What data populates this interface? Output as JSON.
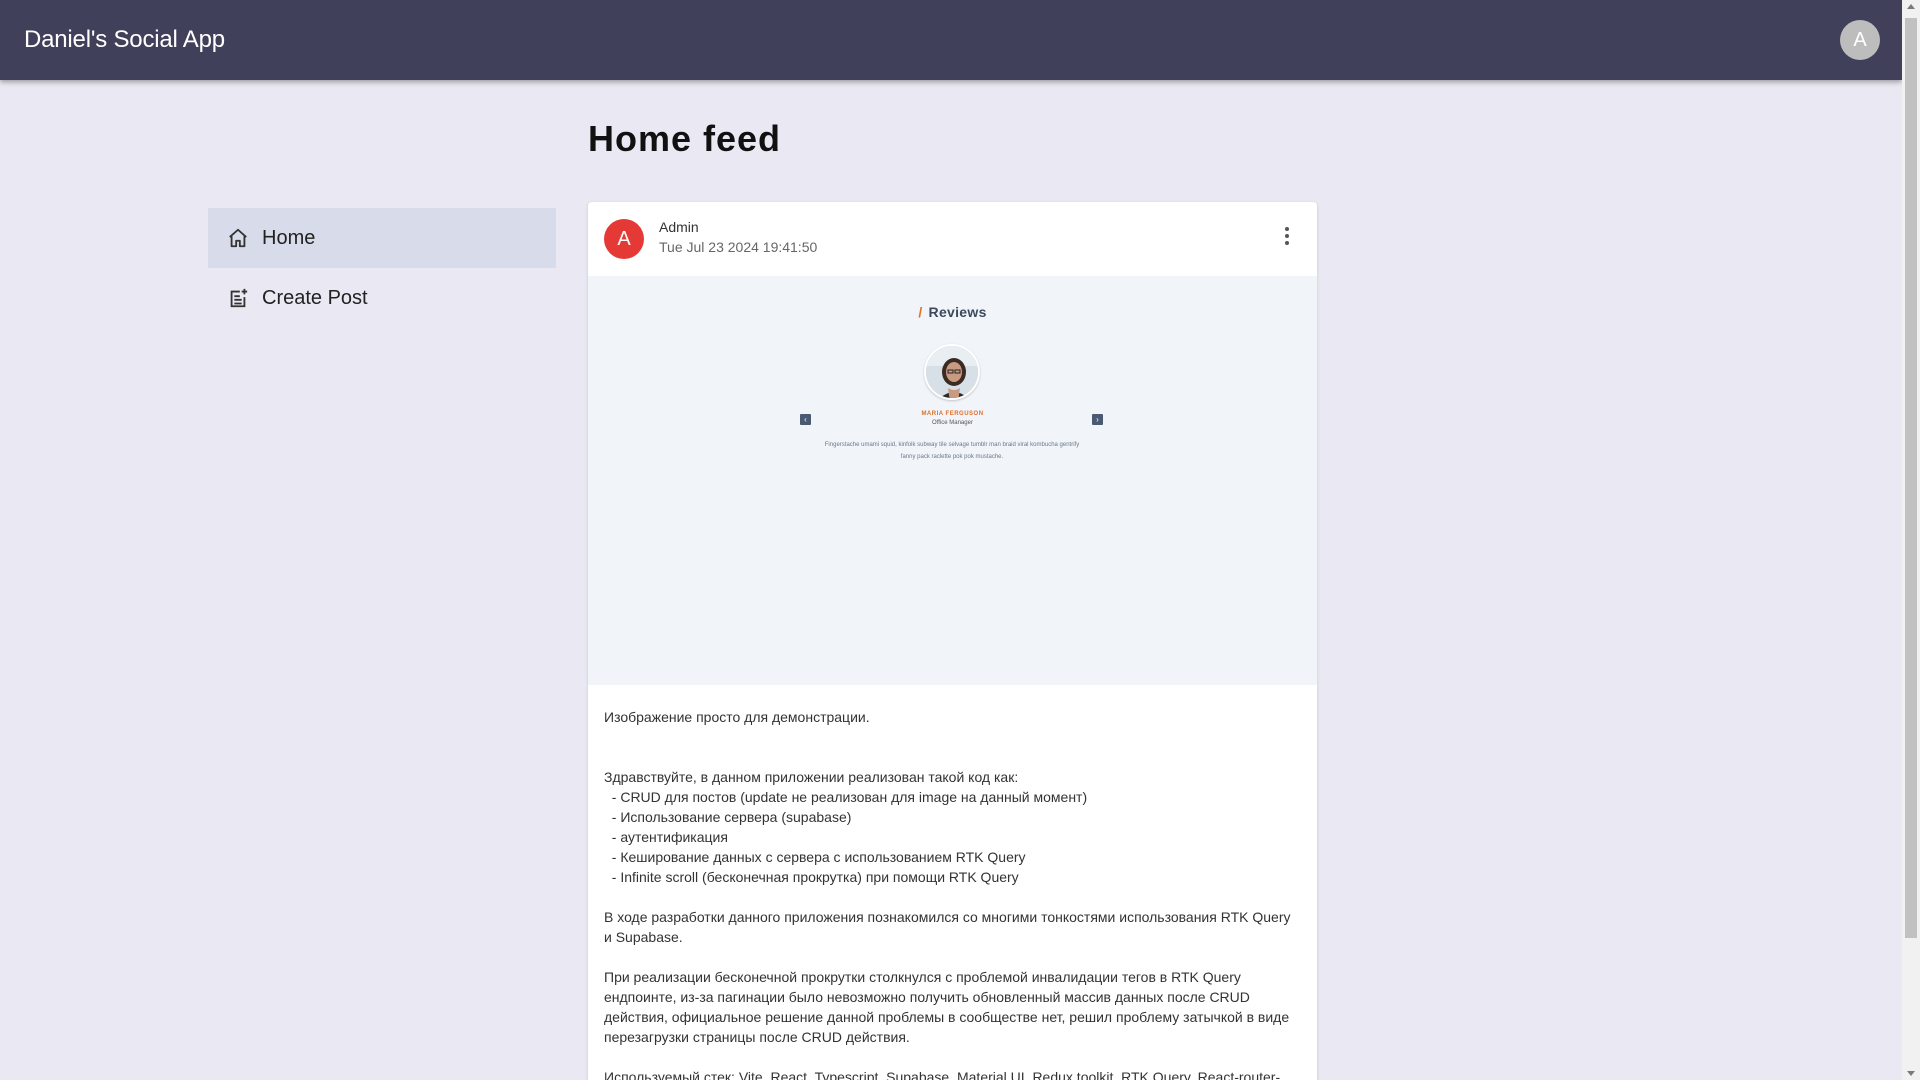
{
  "appbar": {
    "title": "Daniel's Social App",
    "avatar_letter": "A"
  },
  "sidebar": {
    "items": [
      {
        "label": "Home",
        "icon": "home-icon",
        "active": true
      },
      {
        "label": "Create Post",
        "icon": "post-add-icon",
        "active": false
      }
    ]
  },
  "main": {
    "title": "Home feed"
  },
  "post": {
    "avatar_letter": "A",
    "author": "Admin",
    "date": "Tue Jul 23 2024 19:41:50",
    "media": {
      "heading_slash": "/",
      "heading": "Reviews",
      "person_name": "MARIA FERGUSON",
      "person_role": "Office Manager",
      "prev_icon": "‹",
      "next_icon": "›",
      "quote": "Fingerstache umami squid, kinfolk subway tile selvage tumblr man braid viral kombucha gentrify fanny pack raclette pok pok mustache."
    },
    "body": "Изображение просто для демонстрации.\n\n\nЗдравствуйте, в данном приложении реализован такой код как:\n  - CRUD для постов (update не реализован для image на данный момент)\n  - Использование сервера (supabase)\n  - аутентификация\n  - Кеширование данных с сервера с использованием RTK Query\n  - Infinite scroll (бесконечная прокрутка) при помощи RTK Query\n\nВ ходе разработки данного приложения познакомился со многими тонкостями использования RTK Query и Supabase.\n\nПри реализации бесконечной прокрутки столкнулся с проблемой инвалидации тегов в RTK Query ендпоинте, из-за пагинации было невозможно получить обновленный массив данных после CRUD действия, официальное решение данной проблемы в сообществе нет, решил проблему затычкой в виде перезагрузки страницы после CRUD действия.\n\nИспользуемый стек: Vite, React, Typescript, Supabase, Material UI, Redux toolkit, RTK Query, React-router-"
  },
  "colors": {
    "appbar": "#40405a",
    "background": "#eae8f2",
    "active_nav": "#d8dcea",
    "post_avatar": "#e53935",
    "accent_orange": "#e0702a"
  }
}
